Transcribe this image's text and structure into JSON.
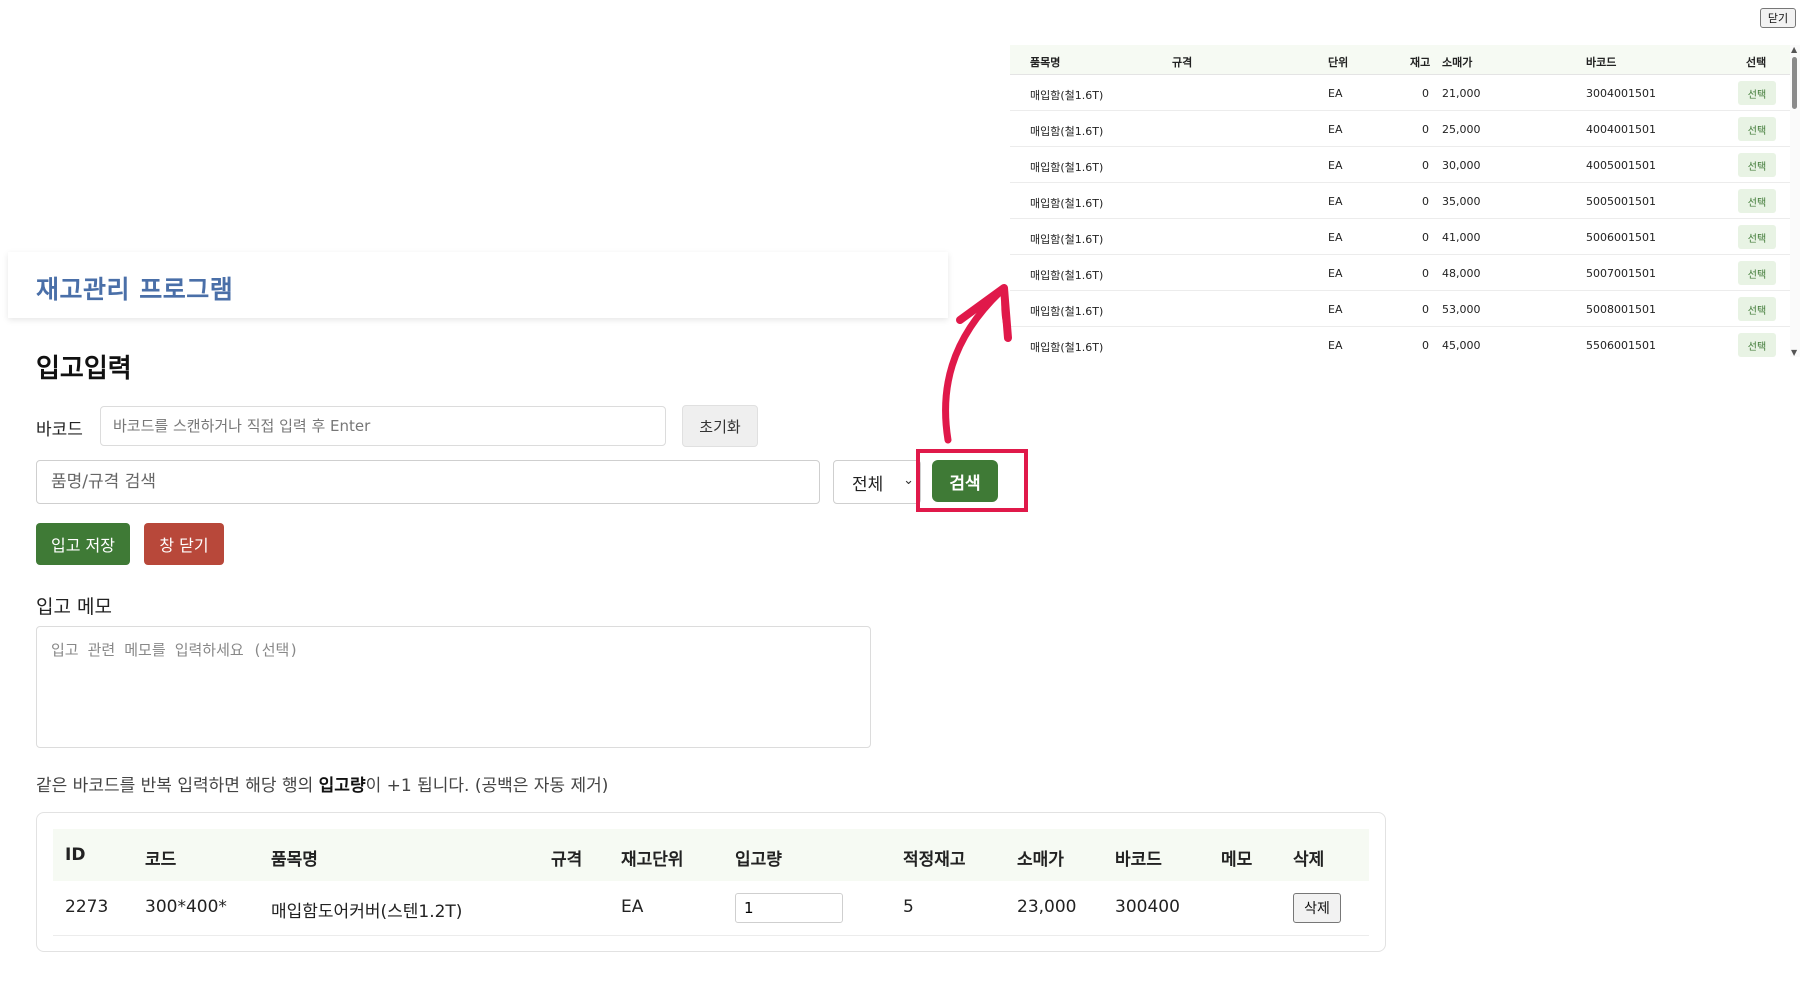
{
  "app": {
    "title": "재고관리 프로그램"
  },
  "page": {
    "title": "입고입력"
  },
  "barcode": {
    "label": "바코드",
    "placeholder": "바코드를 스캔하거나 직접 입력 후 Enter",
    "reset_label": "초기화"
  },
  "search": {
    "placeholder": "품명/규격 검색",
    "filter_value": "전체",
    "button_label": "검색"
  },
  "actions": {
    "save_label": "입고 저장",
    "close_label": "창 닫기"
  },
  "memo": {
    "label": "입고 메모",
    "placeholder": "입고 관련 메모를 입력하세요 (선택)"
  },
  "hint": {
    "prefix": "같은 바코드를 반복 입력하면 해당 행의 ",
    "bold": "입고량",
    "suffix": "이 +1 됩니다. (공백은 자동 제거)"
  },
  "table": {
    "headers": {
      "id": "ID",
      "code": "코드",
      "name": "품목명",
      "spec": "규격",
      "unit": "재고단위",
      "qty": "입고량",
      "proper_stock": "적정재고",
      "price": "소매가",
      "barcode": "바코드",
      "memo": "메모",
      "delete": "삭제"
    },
    "rows": [
      {
        "id": "2273",
        "code": "300*400*",
        "name": "매입함도어커버(스텐1.2T)",
        "spec": "",
        "unit": "EA",
        "qty": "1",
        "proper_stock": "5",
        "price": "23,000",
        "barcode": "300400",
        "memo": "",
        "delete_label": "삭제"
      }
    ]
  },
  "popup": {
    "close_label": "닫기",
    "headers": {
      "name": "품목명",
      "spec": "규격",
      "unit": "단위",
      "stock": "재고",
      "price": "소매가",
      "barcode": "바코드",
      "select": "선택"
    },
    "rows": [
      {
        "name": "매입함(철1.6T)",
        "spec": "",
        "unit": "EA",
        "stock": "0",
        "price": "21,000",
        "barcode": "3004001501",
        "select": "선택"
      },
      {
        "name": "매입함(철1.6T)",
        "spec": "",
        "unit": "EA",
        "stock": "0",
        "price": "25,000",
        "barcode": "4004001501",
        "select": "선택"
      },
      {
        "name": "매입함(철1.6T)",
        "spec": "",
        "unit": "EA",
        "stock": "0",
        "price": "30,000",
        "barcode": "4005001501",
        "select": "선택"
      },
      {
        "name": "매입함(철1.6T)",
        "spec": "",
        "unit": "EA",
        "stock": "0",
        "price": "35,000",
        "barcode": "5005001501",
        "select": "선택"
      },
      {
        "name": "매입함(철1.6T)",
        "spec": "",
        "unit": "EA",
        "stock": "0",
        "price": "41,000",
        "barcode": "5006001501",
        "select": "선택"
      },
      {
        "name": "매입함(철1.6T)",
        "spec": "",
        "unit": "EA",
        "stock": "0",
        "price": "48,000",
        "barcode": "5007001501",
        "select": "선택"
      },
      {
        "name": "매입함(철1.6T)",
        "spec": "",
        "unit": "EA",
        "stock": "0",
        "price": "53,000",
        "barcode": "5008001501",
        "select": "선택"
      },
      {
        "name": "매입함(철1.6T)",
        "spec": "",
        "unit": "EA",
        "stock": "0",
        "price": "45,000",
        "barcode": "5506001501",
        "select": "선택"
      }
    ]
  },
  "colors": {
    "accent_green": "#3f7a36",
    "danger_red": "#b8483a",
    "title_blue": "#4a6fa8",
    "highlight": "#e0194a"
  }
}
